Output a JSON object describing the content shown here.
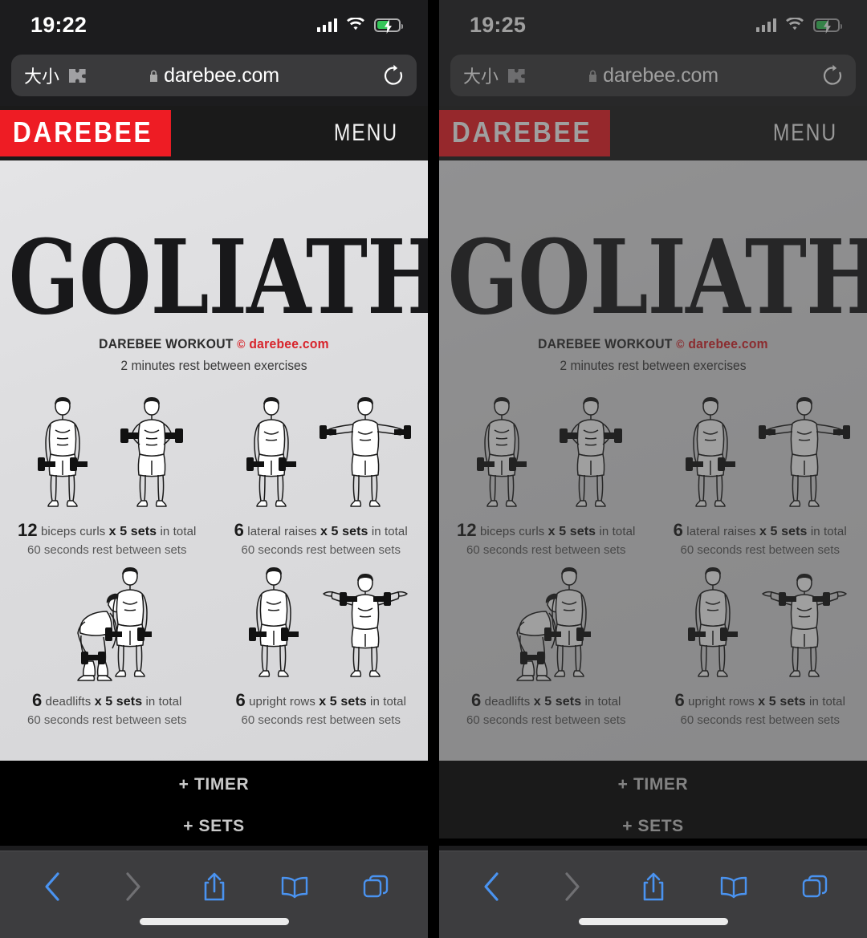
{
  "panels": [
    {
      "id": "left",
      "dimmed": false,
      "status": {
        "time": "19:22",
        "signal_icon": "signal-bars-icon",
        "wifi_icon": "wifi-icon",
        "battery_icon": "battery-charging-icon"
      },
      "urlbar": {
        "text_size_label": "大小",
        "extensions_icon": "puzzle-piece-icon",
        "lock_icon": "lock-icon",
        "url": "darebee.com",
        "reload_icon": "reload-icon"
      }
    },
    {
      "id": "right",
      "dimmed": true,
      "status": {
        "time": "19:25",
        "signal_icon": "signal-bars-icon",
        "wifi_icon": "wifi-icon",
        "battery_icon": "battery-charging-icon"
      },
      "urlbar": {
        "text_size_label": "大小",
        "extensions_icon": "puzzle-piece-icon",
        "lock_icon": "lock-icon",
        "url": "darebee.com",
        "reload_icon": "reload-icon"
      }
    }
  ],
  "site_header": {
    "logo_text": "DAREBEE",
    "menu_label": "MENU"
  },
  "poster": {
    "title": "GOLIATH",
    "credit_prefix": "DAREBEE WORKOUT",
    "credit_copyright": "©",
    "credit_domain": "darebee.com",
    "rest_note": "2 minutes rest between exercises",
    "exercises": [
      {
        "reps": "12",
        "name": "biceps curls",
        "sets": "x 5 sets",
        "suffix": "in total",
        "rest": "60 seconds rest between sets",
        "illustration": "biceps-curls-figures"
      },
      {
        "reps": "6",
        "name": "lateral raises",
        "sets": "x 5 sets",
        "suffix": "in total",
        "rest": "60 seconds rest between sets",
        "illustration": "lateral-raises-figures"
      },
      {
        "reps": "6",
        "name": "deadlifts",
        "sets": "x 5 sets",
        "suffix": "in total",
        "rest": "60 seconds rest between sets",
        "illustration": "deadlifts-figures"
      },
      {
        "reps": "6",
        "name": "upright rows",
        "sets": "x 5 sets",
        "suffix": "in total",
        "rest": "60 seconds rest between sets",
        "illustration": "upright-rows-figures"
      }
    ]
  },
  "page_links": {
    "timer": "+ TIMER",
    "sets": "+ SETS"
  },
  "toolbar": {
    "back_icon": "back-chevron-icon",
    "forward_icon": "forward-chevron-icon",
    "share_icon": "share-icon",
    "bookmarks_icon": "bookmarks-book-icon",
    "tabs_icon": "tabs-icon"
  },
  "colors": {
    "brand_red": "#ee1c24",
    "ios_blue": "#4a93f0",
    "battery_green": "#34c759",
    "poster_bg": "#dcdcde",
    "chrome_bg": "#1c1c1e"
  }
}
